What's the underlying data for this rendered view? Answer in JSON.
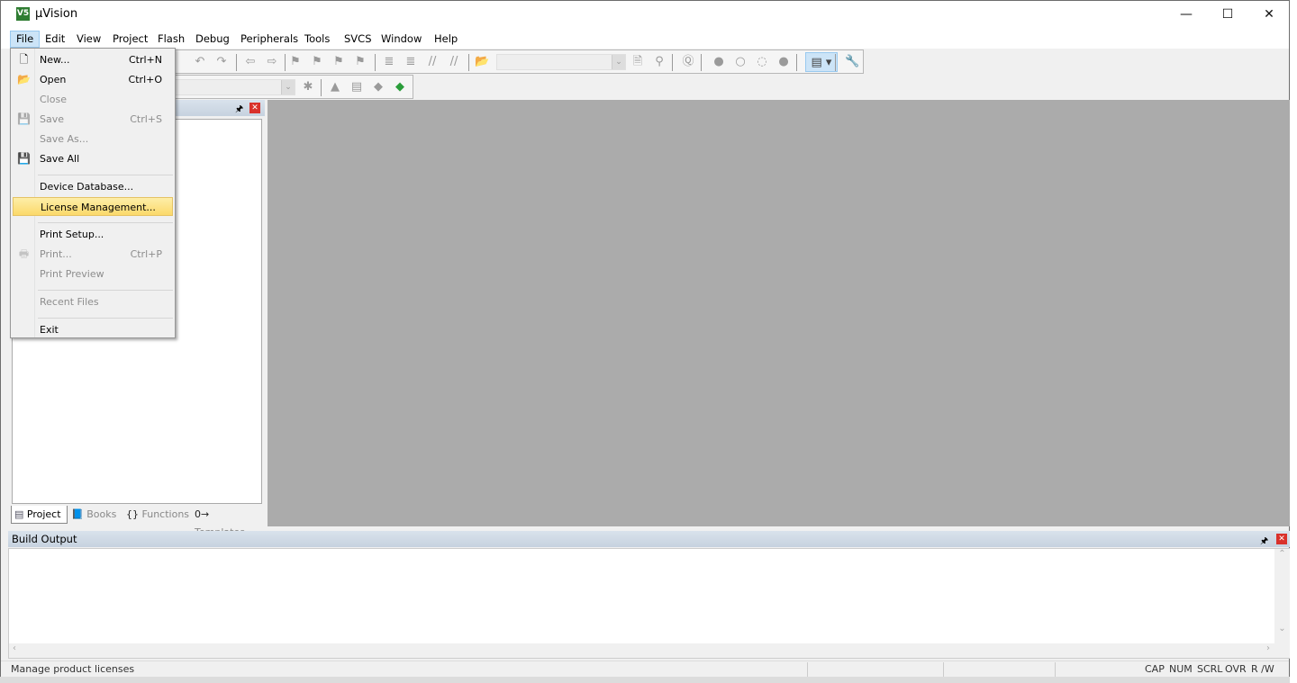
{
  "window": {
    "title": "µVision",
    "app_icon": "V5"
  },
  "menubar": [
    "File",
    "Edit",
    "View",
    "Project",
    "Flash",
    "Debug",
    "Peripherals",
    "Tools",
    "SVCS",
    "Window",
    "Help"
  ],
  "file_menu": [
    {
      "label": "New...",
      "shortcut": "Ctrl+N",
      "icon": "new-file-icon",
      "glyph": "🗋",
      "enabled": true
    },
    {
      "label": "Open",
      "shortcut": "Ctrl+O",
      "icon": "open-folder-icon",
      "glyph": "📂",
      "enabled": true
    },
    {
      "label": "Close",
      "shortcut": "",
      "enabled": false
    },
    {
      "label": "Save",
      "shortcut": "Ctrl+S",
      "icon": "save-icon",
      "glyph": "💾",
      "enabled": false
    },
    {
      "label": "Save As...",
      "shortcut": "",
      "enabled": false
    },
    {
      "label": "Save All",
      "shortcut": "",
      "icon": "save-all-icon",
      "glyph": "💾",
      "enabled": true
    },
    {
      "separator": true
    },
    {
      "label": "Device Database...",
      "shortcut": "",
      "enabled": true
    },
    {
      "label": "License Management...",
      "shortcut": "",
      "enabled": true,
      "highlighted": true
    },
    {
      "separator": true
    },
    {
      "label": "Print Setup...",
      "shortcut": "",
      "enabled": true
    },
    {
      "label": "Print...",
      "shortcut": "Ctrl+P",
      "icon": "printer-icon",
      "glyph": "🖶",
      "enabled": false
    },
    {
      "label": "Print Preview",
      "shortcut": "",
      "enabled": false
    },
    {
      "separator": true
    },
    {
      "label": "Recent Files",
      "shortcut": "",
      "enabled": false
    },
    {
      "separator": true
    },
    {
      "label": "Exit",
      "shortcut": "",
      "enabled": true
    }
  ],
  "left_pane": {
    "tabs": [
      {
        "label": "Project",
        "icon": "project-icon",
        "selected": true
      },
      {
        "label": "Books",
        "icon": "books-icon"
      },
      {
        "label": "Functions",
        "icon": "functions-icon"
      },
      {
        "label": "Templates",
        "icon": "templates-icon"
      }
    ],
    "tab_glyphs": [
      "▤",
      "📘",
      "{}",
      "0→"
    ]
  },
  "build_output": {
    "title": "Build Output"
  },
  "status_bar": {
    "message": "Manage product licenses",
    "indicators": [
      "CAP",
      "NUM",
      "SCRL",
      "OVR",
      "R /W"
    ]
  },
  "colors": {
    "editor_bg": "#ababab",
    "highlight": "#fbd96a",
    "close": "#d9312b"
  }
}
